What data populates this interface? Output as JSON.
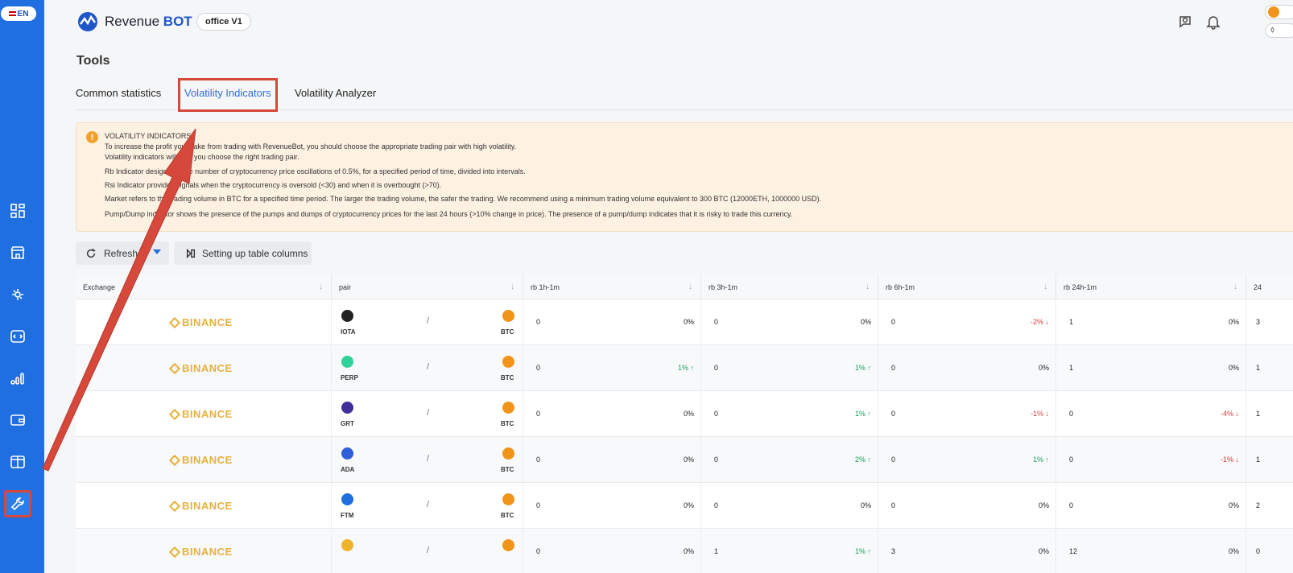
{
  "sidebar": {
    "language": "EN",
    "items": [
      {
        "icon": "dashboard-icon"
      },
      {
        "icon": "store-icon"
      },
      {
        "icon": "settings-bot-icon"
      },
      {
        "icon": "api-icon"
      },
      {
        "icon": "statistics-icon"
      },
      {
        "icon": "wallet-icon"
      },
      {
        "icon": "layout-icon"
      },
      {
        "icon": "tools-wrench-icon"
      }
    ]
  },
  "header": {
    "brand_prefix": "Revenue",
    "brand_suffix": "BOT",
    "office": "office V1"
  },
  "page": {
    "title": "Tools"
  },
  "tabs": [
    "Common statistics",
    "Volatility Indicators",
    "Volatility Analyzer"
  ],
  "notice": {
    "lines": [
      "VOLATILITY INDICATORS",
      "To increase the profit you make from trading with RevenueBot, you should choose the appropriate trading pair with high volatility.",
      "Volatility indicators will help you choose the right trading pair.",
      "Rb Indicator designates the number of cryptocurrency price oscillations of 0.5%, for a specified period of time, divided into intervals.",
      "Rsi Indicator provides signals when the cryptocurrency is oversold (<30) and when it is overbought (>70).",
      "Market refers to the trading volume in BTC for a specified time period. The larger the trading volume, the safer the trading. We recommend using a minimum trading volume equivalent to 300 BTC (12000ETH, 1000000 USD).",
      "Pump/Dump indicator shows the presence of the pumps and dumps of cryptocurrency prices for the last 24 hours (>10% change in price). The presence of a pump/dump indicates that it is risky to trade this currency."
    ]
  },
  "toolbar": {
    "refresh": "Refresh",
    "columns": "Setting up table columns"
  },
  "table": {
    "headers": [
      "Exchange",
      "pair",
      "rb 1h-1m",
      "rb 3h-1m",
      "rb 6h-1m",
      "rb 24h-1m",
      "24"
    ],
    "rows": [
      {
        "exchange": "BINANCE",
        "base": "IOTA",
        "quote": "BTC",
        "base_color": "#222222",
        "cols": [
          [
            "0",
            "0%",
            ""
          ],
          [
            "0",
            "0%",
            ""
          ],
          [
            "0",
            "-2%",
            "down"
          ],
          [
            "1",
            "0%",
            ""
          ]
        ],
        "edge": "3"
      },
      {
        "exchange": "BINANCE",
        "base": "PERP",
        "quote": "BTC",
        "base_color": "#2fd39a",
        "cols": [
          [
            "0",
            "1%",
            "up"
          ],
          [
            "0",
            "1%",
            "up"
          ],
          [
            "0",
            "0%",
            ""
          ],
          [
            "1",
            "0%",
            ""
          ]
        ],
        "edge": "1"
      },
      {
        "exchange": "BINANCE",
        "base": "GRT",
        "quote": "BTC",
        "base_color": "#3f2f9a",
        "cols": [
          [
            "0",
            "0%",
            ""
          ],
          [
            "0",
            "1%",
            "up"
          ],
          [
            "0",
            "-1%",
            "down"
          ],
          [
            "0",
            "-4%",
            "down"
          ]
        ],
        "edge": "1"
      },
      {
        "exchange": "BINANCE",
        "base": "ADA",
        "quote": "BTC",
        "base_color": "#2f5fd8",
        "cols": [
          [
            "0",
            "0%",
            ""
          ],
          [
            "0",
            "2%",
            "up"
          ],
          [
            "0",
            "1%",
            "up"
          ],
          [
            "0",
            "-1%",
            "down"
          ]
        ],
        "edge": "1"
      },
      {
        "exchange": "BINANCE",
        "base": "FTM",
        "quote": "BTC",
        "base_color": "#1f6fe0",
        "cols": [
          [
            "0",
            "0%",
            ""
          ],
          [
            "0",
            "0%",
            ""
          ],
          [
            "0",
            "0%",
            ""
          ],
          [
            "0",
            "0%",
            ""
          ]
        ],
        "edge": "2"
      },
      {
        "exchange": "BINANCE",
        "base": "",
        "quote": "",
        "base_color": "#f0b42c",
        "cols": [
          [
            "0",
            "0%",
            ""
          ],
          [
            "1",
            "1%",
            "up"
          ],
          [
            "3",
            "0%",
            ""
          ],
          [
            "12",
            "0%",
            ""
          ]
        ],
        "edge": "0"
      }
    ]
  },
  "colors": {
    "sidebar": "#1f6fe0",
    "accent": "#2d6fdf",
    "binance": "#e8b13a",
    "up": "#18a05a",
    "down": "#e03a3a",
    "highlight": "#d5483b"
  }
}
